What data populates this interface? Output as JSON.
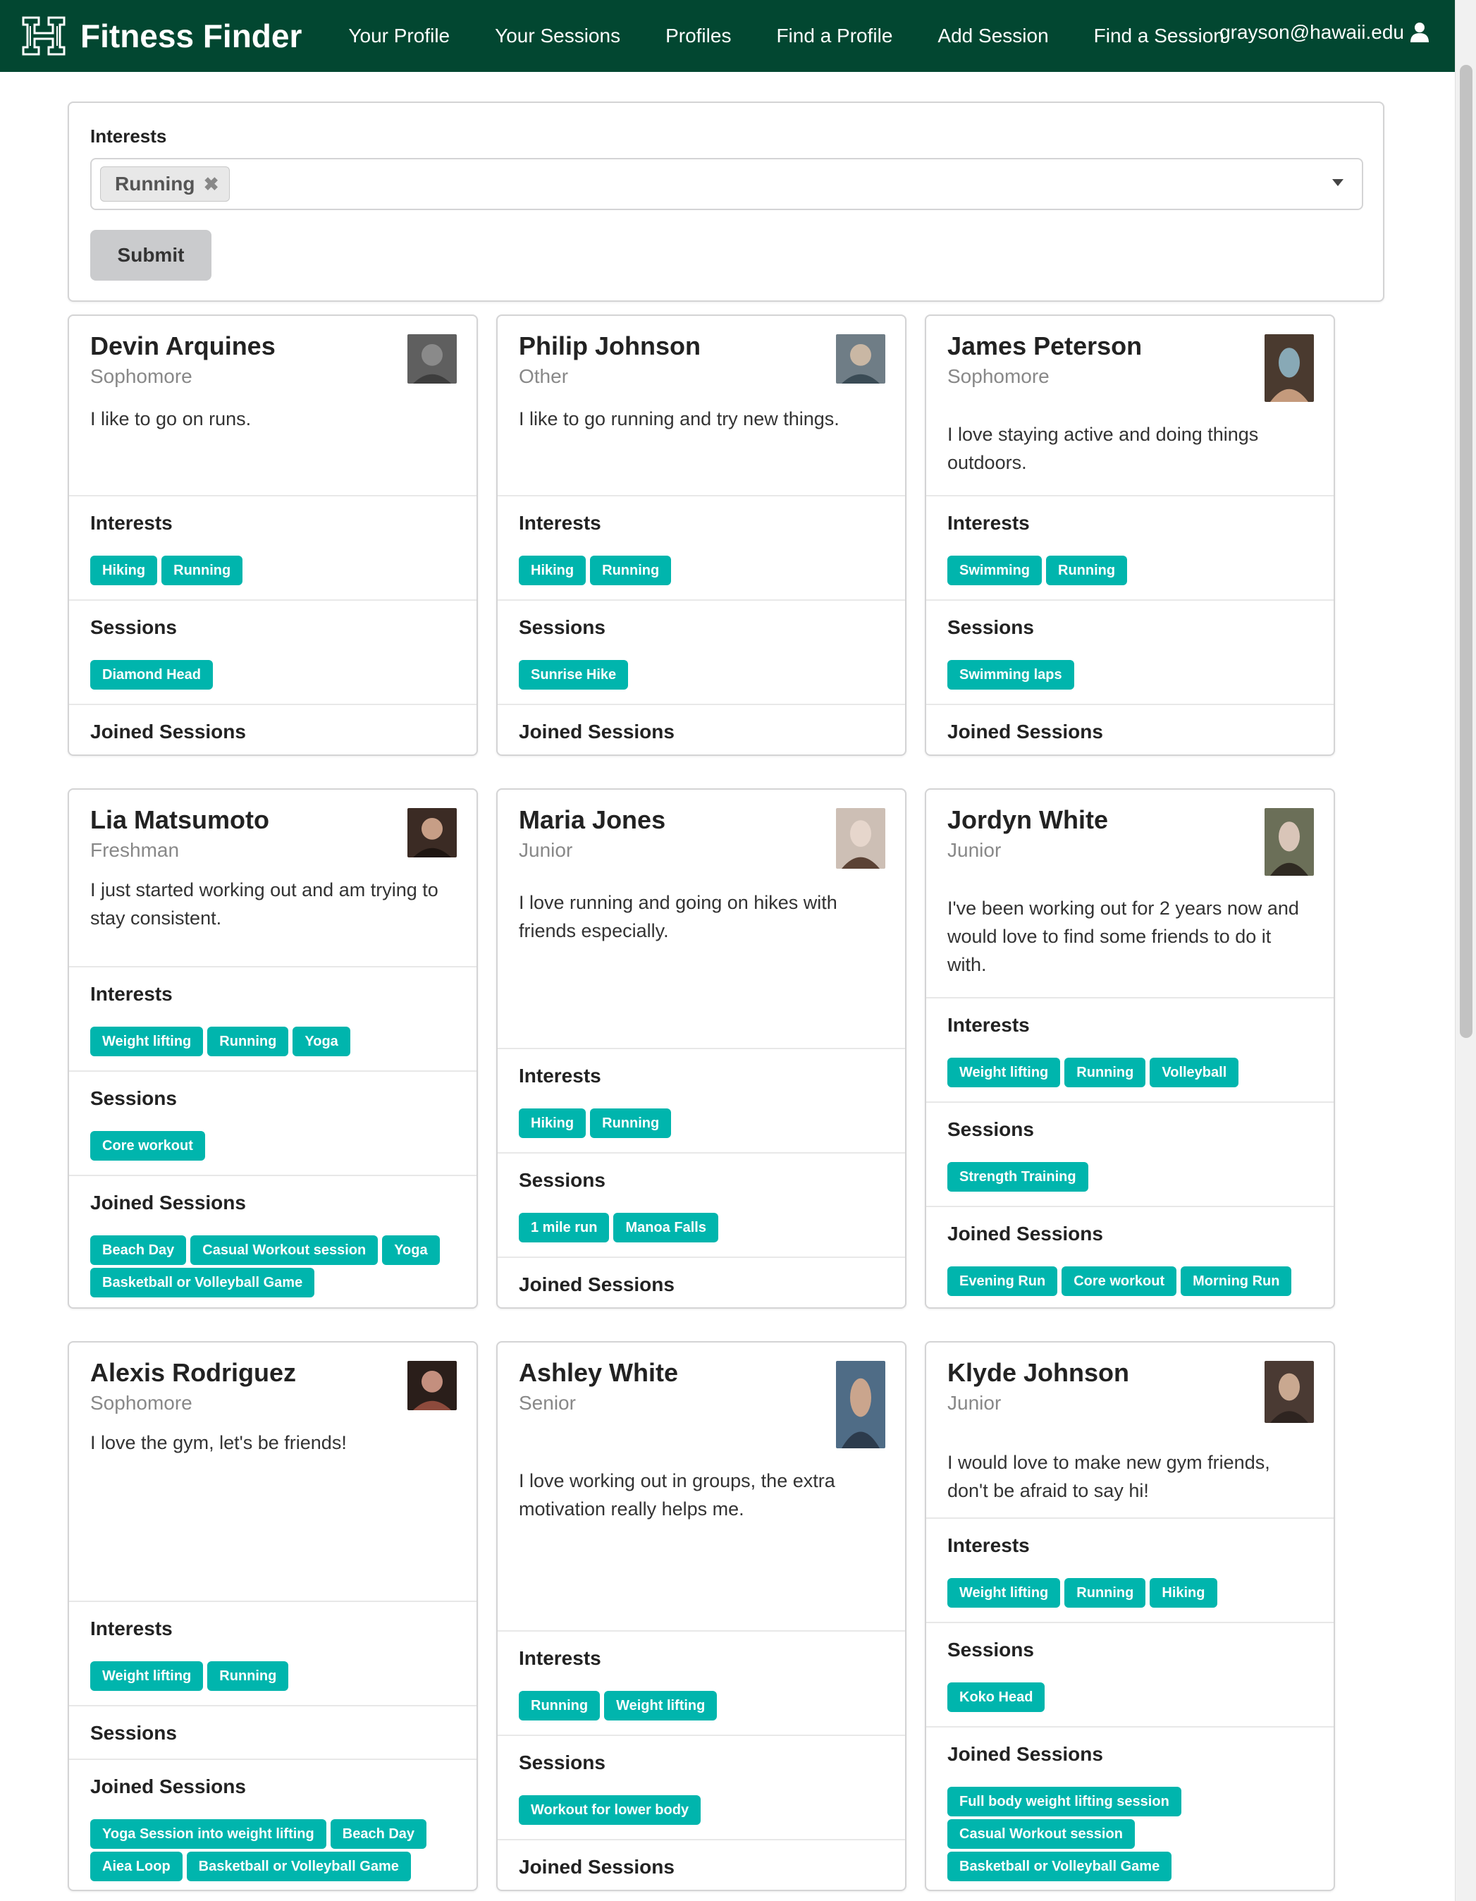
{
  "nav": {
    "brand": "Fitness Finder",
    "items": [
      "Your Profile",
      "Your Sessions",
      "Profiles",
      "Find a Profile",
      "Add Session",
      "Find a Session"
    ],
    "user": "grayson@hawaii.edu"
  },
  "filter": {
    "label": "Interests",
    "selected": "Running",
    "remove_glyph": "✖",
    "submit_label": "Submit"
  },
  "labels": {
    "interests": "Interests",
    "sessions": "Sessions",
    "joined": "Joined Sessions"
  },
  "profiles": [
    {
      "name": "Devin Arquines",
      "year": "Sophomore",
      "description": "I like to go on runs.",
      "interests": [
        "Hiking",
        "Running"
      ],
      "sessions": [
        "Diamond Head"
      ],
      "joined": []
    },
    {
      "name": "Philip Johnson",
      "year": "Other",
      "description": "I like to go running and try new things.",
      "interests": [
        "Hiking",
        "Running"
      ],
      "sessions": [
        "Sunrise Hike"
      ],
      "joined": []
    },
    {
      "name": "James Peterson",
      "year": "Sophomore",
      "description": "I love staying active and doing things outdoors.",
      "interests": [
        "Swimming",
        "Running"
      ],
      "sessions": [
        "Swimming laps"
      ],
      "joined": []
    },
    {
      "name": "Lia Matsumoto",
      "year": "Freshman",
      "description": "I just started working out and am trying to stay consistent.",
      "interests": [
        "Weight lifting",
        "Running",
        "Yoga"
      ],
      "sessions": [
        "Core workout"
      ],
      "joined": [
        "Beach Day",
        "Casual Workout session",
        "Yoga",
        "Basketball or Volleyball Game"
      ]
    },
    {
      "name": "Maria Jones",
      "year": "Junior",
      "description": "I love running and going on hikes with friends especially.",
      "interests": [
        "Hiking",
        "Running"
      ],
      "sessions": [
        "1 mile run",
        "Manoa Falls"
      ],
      "joined": []
    },
    {
      "name": "Jordyn White",
      "year": "Junior",
      "description": "I've been working out for 2 years now and would love to find some friends to do it with.",
      "interests": [
        "Weight lifting",
        "Running",
        "Volleyball"
      ],
      "sessions": [
        "Strength Training"
      ],
      "joined": [
        "Evening Run",
        "Core workout",
        "Morning Run"
      ]
    },
    {
      "name": "Alexis Rodriguez",
      "year": "Sophomore",
      "description": "I love the gym, let's be friends!",
      "interests": [
        "Weight lifting",
        "Running"
      ],
      "sessions": [],
      "joined": [
        "Yoga Session into weight lifting",
        "Beach Day",
        "Aiea Loop",
        "Basketball or Volleyball Game"
      ]
    },
    {
      "name": "Ashley White",
      "year": "Senior",
      "description": "I love working out in groups, the extra motivation really helps me.",
      "interests": [
        "Running",
        "Weight lifting"
      ],
      "sessions": [
        "Workout for lower body"
      ],
      "joined": []
    },
    {
      "name": "Klyde Johnson",
      "year": "Junior",
      "description": "I would love to make new gym friends, don't be afraid to say hi!",
      "interests": [
        "Weight lifting",
        "Running",
        "Hiking"
      ],
      "sessions": [
        "Koko Head"
      ],
      "joined": [
        "Full body weight lifting session",
        "Casual Workout session",
        "Basketball or Volleyball Game"
      ]
    }
  ]
}
